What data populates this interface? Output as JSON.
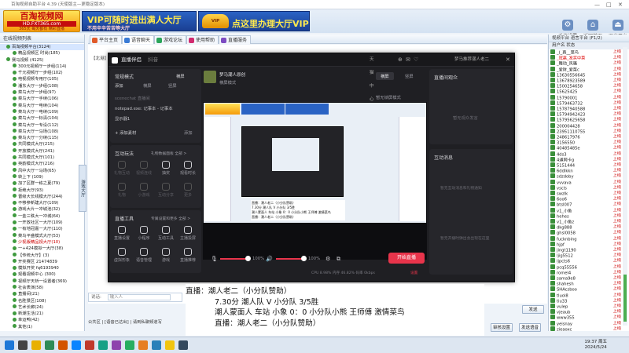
{
  "window": {
    "title": "百淘视频自助平台 4.39 (天使版主—更稳定版本)",
    "minimize": "—",
    "maximize": "□",
    "close": "✕"
  },
  "banner": {
    "logo_line1": "百淘视频网",
    "logo_line2": "HD.FXT365.com",
    "logo_line3": "365天 每天都有 精彩直播",
    "ad1_big": "VIP可随时进出满人大厅",
    "ad1_small": "不用辛辛苦苦等大厅",
    "ad2_big": "点这里办理大厅VIP",
    "ad_badge": "VIP",
    "tools": [
      {
        "label": "系统设置",
        "icon": "⚙"
      },
      {
        "label": "返回首页",
        "icon": "⌂"
      },
      {
        "label": "退出平台",
        "icon": "⏏"
      }
    ]
  },
  "left": {
    "header": "在线视频列表",
    "items": [
      {
        "t": "百淘视频平台(3124)",
        "sel": true
      },
      {
        "t": "精品视频区 时尚(185)"
      },
      {
        "t": "赛马视频 (4125)"
      },
      {
        "t": "300元视频厅一步组(114)"
      },
      {
        "t": "千元视频厅一步组(102)"
      },
      {
        "t": "电视视频专用厅(105)"
      },
      {
        "t": "潘东大厅一步组(108)"
      },
      {
        "t": "菜鸟大厅一步组(97)"
      },
      {
        "t": "菜鸟大厅一手续(106)"
      },
      {
        "t": "菜鸟大厅一电续(104)"
      },
      {
        "t": "菜鸟大厅一电续(109)"
      },
      {
        "t": "菜鸟大厅一标清(104)"
      },
      {
        "t": "菜鸟大厅一专设(112)"
      },
      {
        "t": "菜鸟大厅一马场(108)"
      },
      {
        "t": "菜鸟大厅一分续(115)"
      },
      {
        "t": "共同模式大厅(215)"
      },
      {
        "t": "开放模式大厅(241)"
      },
      {
        "t": "共同模式大厅(101)"
      },
      {
        "t": "英韵模式大厅(216)"
      },
      {
        "t": "风中大厅一马场(65)"
      },
      {
        "t": "转上下 (109)"
      },
      {
        "t": "加了区群一栋之夏(79)"
      },
      {
        "t": "拒绝大厅(93)"
      },
      {
        "t": "晋级大长线模大厅(244)"
      },
      {
        "t": "不够参新建大厅(109)"
      },
      {
        "t": "游戏大片一冲城池(32)"
      },
      {
        "t": "一金三秩大一冲城(64)"
      },
      {
        "t": "一开放社区一大厅(109)"
      },
      {
        "t": "一有地冠嘉一大厅(110)"
      },
      {
        "t": "菜鸟平盛模式大厅(53)"
      },
      {
        "t": "少视版精品视大厅(10)",
        "red": true
      },
      {
        "t": "一+424模拟一大厅(38)"
      },
      {
        "t": "【传统大厅】(3)"
      },
      {
        "t": "开奖赛区 21474839"
      },
      {
        "t": "模拟开奖 fq6193940"
      },
      {
        "t": "观看视频中心 (300)"
      },
      {
        "t": "视频厅天桥一设置者(369)"
      },
      {
        "t": "社会表演(58)"
      },
      {
        "t": "直播间(21)"
      },
      {
        "t": "名胜景区(108)"
      },
      {
        "t": "艺术长廊(24)"
      },
      {
        "t": "新潮生活(21)"
      },
      {
        "t": "幸运鸭(42)"
      },
      {
        "t": "其他(1)"
      }
    ]
  },
  "left_tab": "游戏大厅",
  "tabs": [
    {
      "label": "平台主页",
      "active": false
    },
    {
      "label": "语音聊天",
      "active": true
    },
    {
      "label": "游戏论坛",
      "active": false
    },
    {
      "label": "使用帮助",
      "active": false
    },
    {
      "label": "直播服务",
      "active": false
    }
  ],
  "inner_tab": "【北港】",
  "chat": {
    "input_label": "说话:",
    "input_placeholder": "输入人",
    "strip": "公共区  |  [语音已达出]  |  请到私聊频道写"
  },
  "right_buttons": {
    "send": "发送",
    "a": "审核设置",
    "b": "发送语音"
  },
  "right": {
    "tabs": "视频平台  语言平台 (F1/2)",
    "head": "用户名      状态",
    "users": [
      {
        "n": "_(_真__菜鸟",
        "s": "上线"
      },
      {
        "n": "_冠嘉_发奖中菜",
        "s": "上线",
        "red": true
      },
      {
        "n": "_舞动_风骚",
        "s": "上线"
      },
      {
        "n": "_爱财_爱菜c",
        "s": "上线"
      },
      {
        "n": "13630556645",
        "s": "上线"
      },
      {
        "n": "13678923589",
        "s": "上线"
      },
      {
        "n": "1500254658",
        "s": "上线"
      },
      {
        "n": "15625425",
        "s": "上线"
      },
      {
        "n": "15790001",
        "s": "上线"
      },
      {
        "n": "1579463732",
        "s": "上线"
      },
      {
        "n": "15787940588",
        "s": "上线"
      },
      {
        "n": "15794942423",
        "s": "上线"
      },
      {
        "n": "15795625658",
        "s": "上线"
      },
      {
        "n": "200004428",
        "s": "上线"
      },
      {
        "n": "23951110755",
        "s": "上线"
      },
      {
        "n": "248617976",
        "s": "上线"
      },
      {
        "n": "3156550",
        "s": "上线"
      },
      {
        "n": "40485485e",
        "s": "上线"
      },
      {
        "n": "4ds3",
        "s": "上线"
      },
      {
        "n": "4通网卡g",
        "s": "上线"
      },
      {
        "n": "5151444",
        "s": "上线"
      },
      {
        "n": "6ddlkkn",
        "s": "上线"
      },
      {
        "n": "sdzdoby",
        "s": "上线"
      },
      {
        "n": "vvvava",
        "s": "上线"
      },
      {
        "n": "vscls",
        "s": "上线"
      },
      {
        "n": "swzlk",
        "s": "上线"
      },
      {
        "n": "6oo6",
        "s": "上线"
      },
      {
        "n": "btsl007",
        "s": "上线"
      },
      {
        "n": "v1_小鱼",
        "s": "上线"
      },
      {
        "n": "hehes",
        "s": "上线"
      },
      {
        "n": "v1_小鱼z",
        "s": "上线"
      },
      {
        "n": "dkg888",
        "s": "上线"
      },
      {
        "n": "ghsl0058",
        "s": "上线"
      },
      {
        "n": "fucknbing",
        "s": "上线"
      },
      {
        "n": "hjpf",
        "s": "上线"
      },
      {
        "n": "jingt1190",
        "s": "上线"
      },
      {
        "n": "ljig5512",
        "s": "上线"
      },
      {
        "n": "ljpcts6",
        "s": "上线"
      },
      {
        "n": "pcq55556",
        "s": "上线"
      },
      {
        "n": "romel4",
        "s": "上线"
      },
      {
        "n": "sama9e8",
        "s": "上线"
      },
      {
        "n": "shahesh",
        "s": "上线"
      },
      {
        "n": "SHAcsboo",
        "s": "上线"
      },
      {
        "n": "tluol8",
        "s": "上线"
      },
      {
        "n": "tiu33",
        "s": "上线"
      },
      {
        "n": "vulep",
        "s": "上线"
      },
      {
        "n": "vjeaub",
        "s": "上线"
      },
      {
        "n": "www355",
        "s": "上线"
      },
      {
        "n": "yeisnay",
        "s": "上线"
      },
      {
        "n": "zieaoxc",
        "s": "上线"
      }
    ]
  },
  "stream": {
    "title": "直播伴侣",
    "subtitle": "抖音",
    "header_right": [
      "天猫中心",
      "⊕",
      "✉",
      "♡"
    ],
    "user": "梦马推荐潮人老二",
    "scene_tabs": [
      "常规模式",
      "横屏",
      "竖屏"
    ],
    "scene_add": "添加",
    "sources": [
      "scenechat 直播间",
      "notepad.exe: 记事本 - 记事本",
      "显示器1"
    ],
    "add_source": "+ 添加素材",
    "add_source2": "添加",
    "interact_title": "互动玩法",
    "interact_note": "礼物数据面板 全部 >",
    "interact_items": [
      {
        "l": "礼物互动",
        "dim": true
      },
      {
        "l": "视频连线",
        "dim": true
      },
      {
        "l": "抽奖",
        "dim": false
      },
      {
        "l": "观看时长",
        "dim": false
      },
      {
        "l": "礼物",
        "dim": true
      },
      {
        "l": "小游戏",
        "dim": true
      },
      {
        "l": "互动分享",
        "dim": true
      },
      {
        "l": "更多",
        "dim": true
      }
    ],
    "tools_title": "直播工具",
    "tools_note": "专属设置和更多 全部 >",
    "tools": [
      {
        "l": "直播设置"
      },
      {
        "l": "小程序"
      },
      {
        "l": "互动工具"
      },
      {
        "l": "主播投屏"
      },
      {
        "l": "虚拟形象"
      },
      {
        "l": "语音管理"
      },
      {
        "l": "游戏"
      },
      {
        "l": "直播推荐"
      }
    ],
    "preview_title": "梦马潮人原创",
    "preview_sub": "横屏模式",
    "mode_tabs": [
      "横屏",
      "竖屏"
    ],
    "unlock": "暂无锁屏模式",
    "comments_title": "直播间观众",
    "comments_empty": "暂无观众发言",
    "messages_title": "互动消息",
    "messages_empty1": "暂无互动消息和礼物通知",
    "messages_empty2": "暂无开播时弹出会出现在这里",
    "vol1": "100%",
    "vol2": "100%",
    "start_btn": "开始直播",
    "status": "CPU 8.98%   内存 46.82%   码率 0kbps",
    "status_right": "设置"
  },
  "overlay": {
    "line1": "直播：潮人老二（小分队赞助）",
    "line2": "7.30分                    潮人队 V 小分队           3/5胜",
    "line3": "潮人蒙面人 车站 小象    0：0  小分队小熊  王师傅  激情菜鸟",
    "line4": "直播：潮人老二（小分队赞助）"
  },
  "taskbar": {
    "time": "19:37 周五",
    "date": "2024/5/24"
  }
}
